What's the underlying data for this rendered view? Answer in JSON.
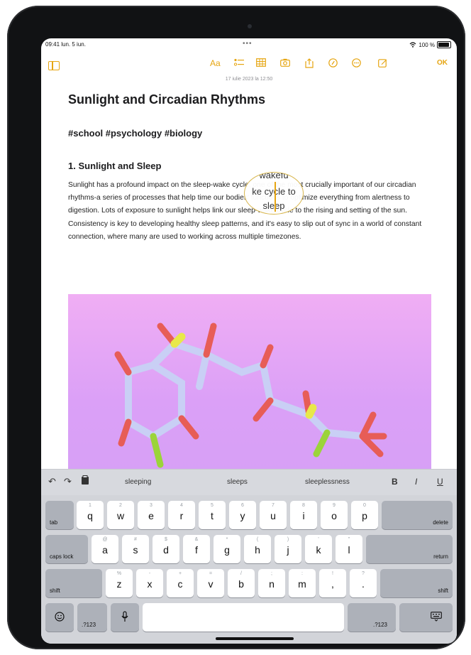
{
  "status": {
    "time": "09:41 lun. 5 iun.",
    "battery": "100 %"
  },
  "toolbar": {
    "format_label": "Aa",
    "ok_label": "OK"
  },
  "note": {
    "date": "17 iulie 2023 la 12:50",
    "title": "Sunlight and Circadian Rhythms",
    "tags": "#school #psychology #biology",
    "heading": "1. Sunlight and Sleep",
    "paragraph": "Sunlight has a profound impact on the sleep-wake cycle, one of the most crucially important of our circadian rhythms-a series of processes that help time our bodies' functions to optimize everything from alertness to digestion. Lots of exposure to sunlight helps link our sleep-wake cycle to the rising and setting of the sun. Consistency is key to developing healthy sleep patterns, and it's easy to slip out of sync in a world of constant connection, where many are used to working across multiple timezones.",
    "loupe": {
      "top": "wakefu",
      "middle": "ke cycle to",
      "bottom": "sleep"
    }
  },
  "shortcut_bar": {
    "suggestions": [
      "sleeping",
      "sleeps",
      "sleeplessness"
    ],
    "bold": "B",
    "italic": "I",
    "underline": "U"
  },
  "keyboard": {
    "row1": [
      {
        "sub": "1",
        "main": "q"
      },
      {
        "sub": "2",
        "main": "w"
      },
      {
        "sub": "3",
        "main": "e"
      },
      {
        "sub": "4",
        "main": "r"
      },
      {
        "sub": "5",
        "main": "t"
      },
      {
        "sub": "6",
        "main": "y"
      },
      {
        "sub": "7",
        "main": "u"
      },
      {
        "sub": "8",
        "main": "i"
      },
      {
        "sub": "9",
        "main": "o"
      },
      {
        "sub": "0",
        "main": "p"
      }
    ],
    "row2": [
      {
        "sub": "@",
        "main": "a"
      },
      {
        "sub": "#",
        "main": "s"
      },
      {
        "sub": "$",
        "main": "d"
      },
      {
        "sub": "&",
        "main": "f"
      },
      {
        "sub": "*",
        "main": "g"
      },
      {
        "sub": "(",
        "main": "h"
      },
      {
        "sub": ")",
        "main": "j"
      },
      {
        "sub": "'",
        "main": "k"
      },
      {
        "sub": "\"",
        "main": "l"
      }
    ],
    "row3": [
      {
        "sub": "%",
        "main": "z"
      },
      {
        "sub": "-",
        "main": "x"
      },
      {
        "sub": "+",
        "main": "c"
      },
      {
        "sub": "=",
        "main": "v"
      },
      {
        "sub": "/",
        "main": "b"
      },
      {
        "sub": ";",
        "main": "n"
      },
      {
        "sub": ":",
        "main": "m"
      },
      {
        "sub": "!",
        "main": ","
      },
      {
        "sub": "?",
        "main": "."
      }
    ],
    "tab": "tab",
    "delete": "delete",
    "caps": "caps lock",
    "return": "return",
    "shift": "shift",
    "num": ".?123"
  }
}
